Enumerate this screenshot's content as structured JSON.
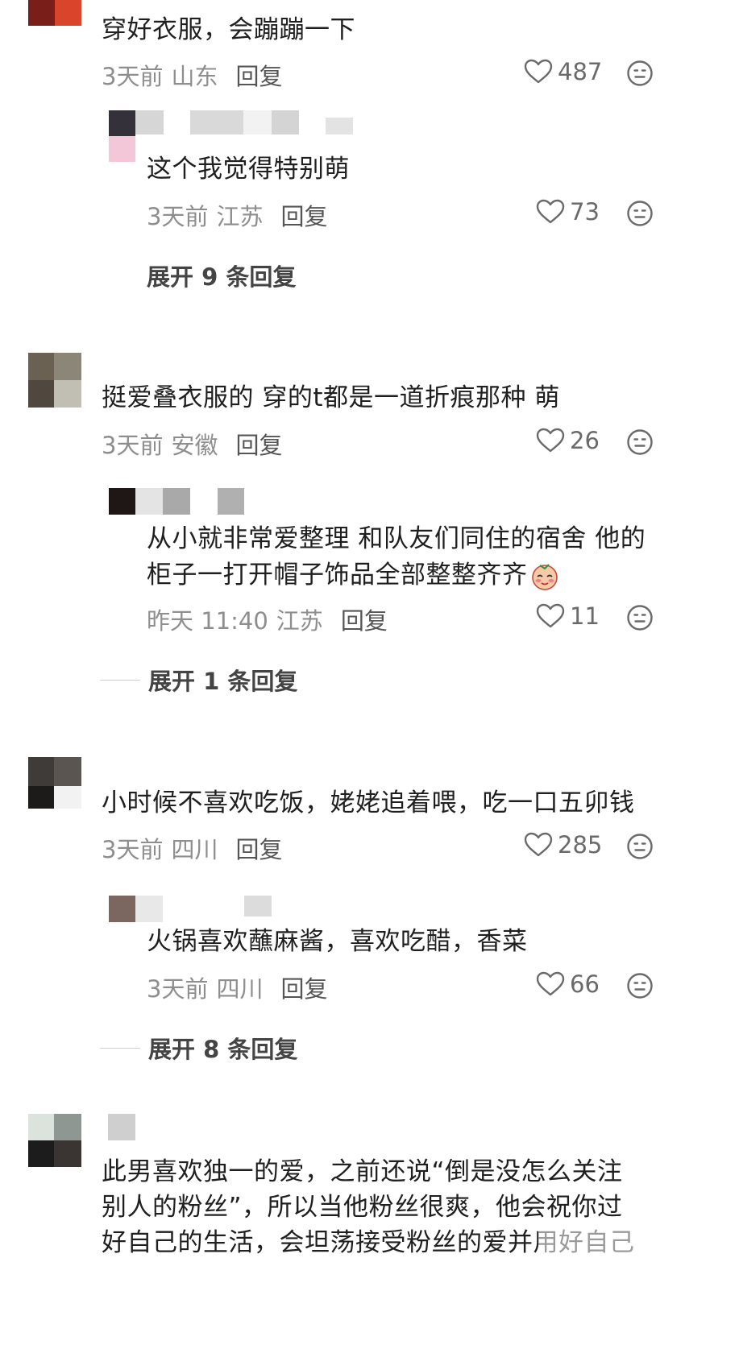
{
  "comments": [
    {
      "text": "穿好衣服，会蹦蹦一下",
      "time": "3天前",
      "location": "山东",
      "reply_label": "回复",
      "likes": "487",
      "sub_reply": {
        "text": "这个我觉得特别萌",
        "time": "3天前",
        "location": "江苏",
        "reply_label": "回复",
        "likes": "73"
      },
      "expand_label": "展开 9 条回复"
    },
    {
      "text": "挺爱叠衣服的 穿的t都是一道折痕那种 萌",
      "time": "3天前",
      "location": "安徽",
      "reply_label": "回复",
      "likes": "26",
      "sub_reply": {
        "text_line1": "从小就非常爱整理 和队友们同住的宿舍 他的",
        "text_line2": "柜子一打开帽子饰品全部整整齐齐",
        "time": "昨天 11:40",
        "location": "江苏",
        "reply_label": "回复",
        "likes": "11"
      },
      "expand_label": "展开 1 条回复"
    },
    {
      "text": "小时候不喜欢吃饭，姥姥追着喂，吃一口五卯钱",
      "time": "3天前",
      "location": "四川",
      "reply_label": "回复",
      "likes": "285",
      "sub_reply": {
        "text": "火锅喜欢蘸麻酱，喜欢吃醋，香菜",
        "time": "3天前",
        "location": "四川",
        "reply_label": "回复",
        "likes": "66"
      },
      "expand_label": "展开 8 条回复"
    },
    {
      "text_line1": "此男喜欢独一的爱，之前还说“倒是没怎么关注",
      "text_line2": "别人的粉丝”，所以当他粉丝很爽，他会祝你过",
      "text_line3": "好自己的生活，会坦荡接受粉丝的爱并用好自己"
    }
  ],
  "icons": {
    "like": "heart-outline-icon",
    "emoji": "neutral-face-icon",
    "sticker": "blushing-face-emoji"
  },
  "colors": {
    "text": "#1f1f1f",
    "meta": "#8e8e8e",
    "divider": "#cfcfcf"
  }
}
